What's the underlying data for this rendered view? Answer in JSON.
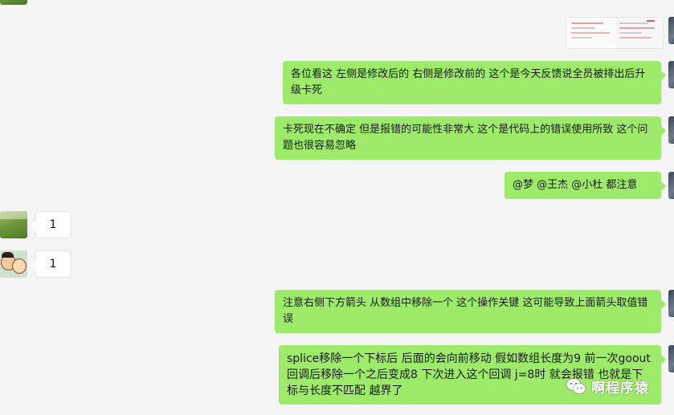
{
  "chat": {
    "messages": [
      {
        "side": "right",
        "type": "image",
        "alt": "screenshot"
      },
      {
        "side": "right",
        "type": "text",
        "text": "各位看这 左侧是修改后的 右侧是修改前的  这个是今天反馈说全员被排出后升级卡死"
      },
      {
        "side": "right",
        "type": "text",
        "text": "卡死现在不确定 但是报错的可能性非常大 这个是代码上的错误使用所致 这个问题也很容易忽略"
      },
      {
        "side": "right",
        "type": "text",
        "text": "@梦 @王杰 @小杜  都注意"
      },
      {
        "side": "left",
        "type": "text",
        "text": "1"
      },
      {
        "side": "left",
        "type": "text",
        "text": "1"
      },
      {
        "side": "right",
        "type": "text",
        "text": "注意右侧下方箭头 从数组中移除一个 这个操作关键 这可能导致上面箭头取值错误"
      },
      {
        "side": "right",
        "type": "text",
        "text": "splice移除一个下标后 后面的会向前移动  假如数组长度为9  前一次goout回调后移除一个之后变成8  下次进入这个回调 j=8时 就会报错 也就是下标与长度不匹配 越界了"
      }
    ]
  },
  "watermark": {
    "label": "啊程序猿",
    "icon": "wechat-icon"
  },
  "colors": {
    "background": "#f5f5f5",
    "outgoing_bubble": "#9eea6a",
    "incoming_bubble": "#ffffff"
  }
}
